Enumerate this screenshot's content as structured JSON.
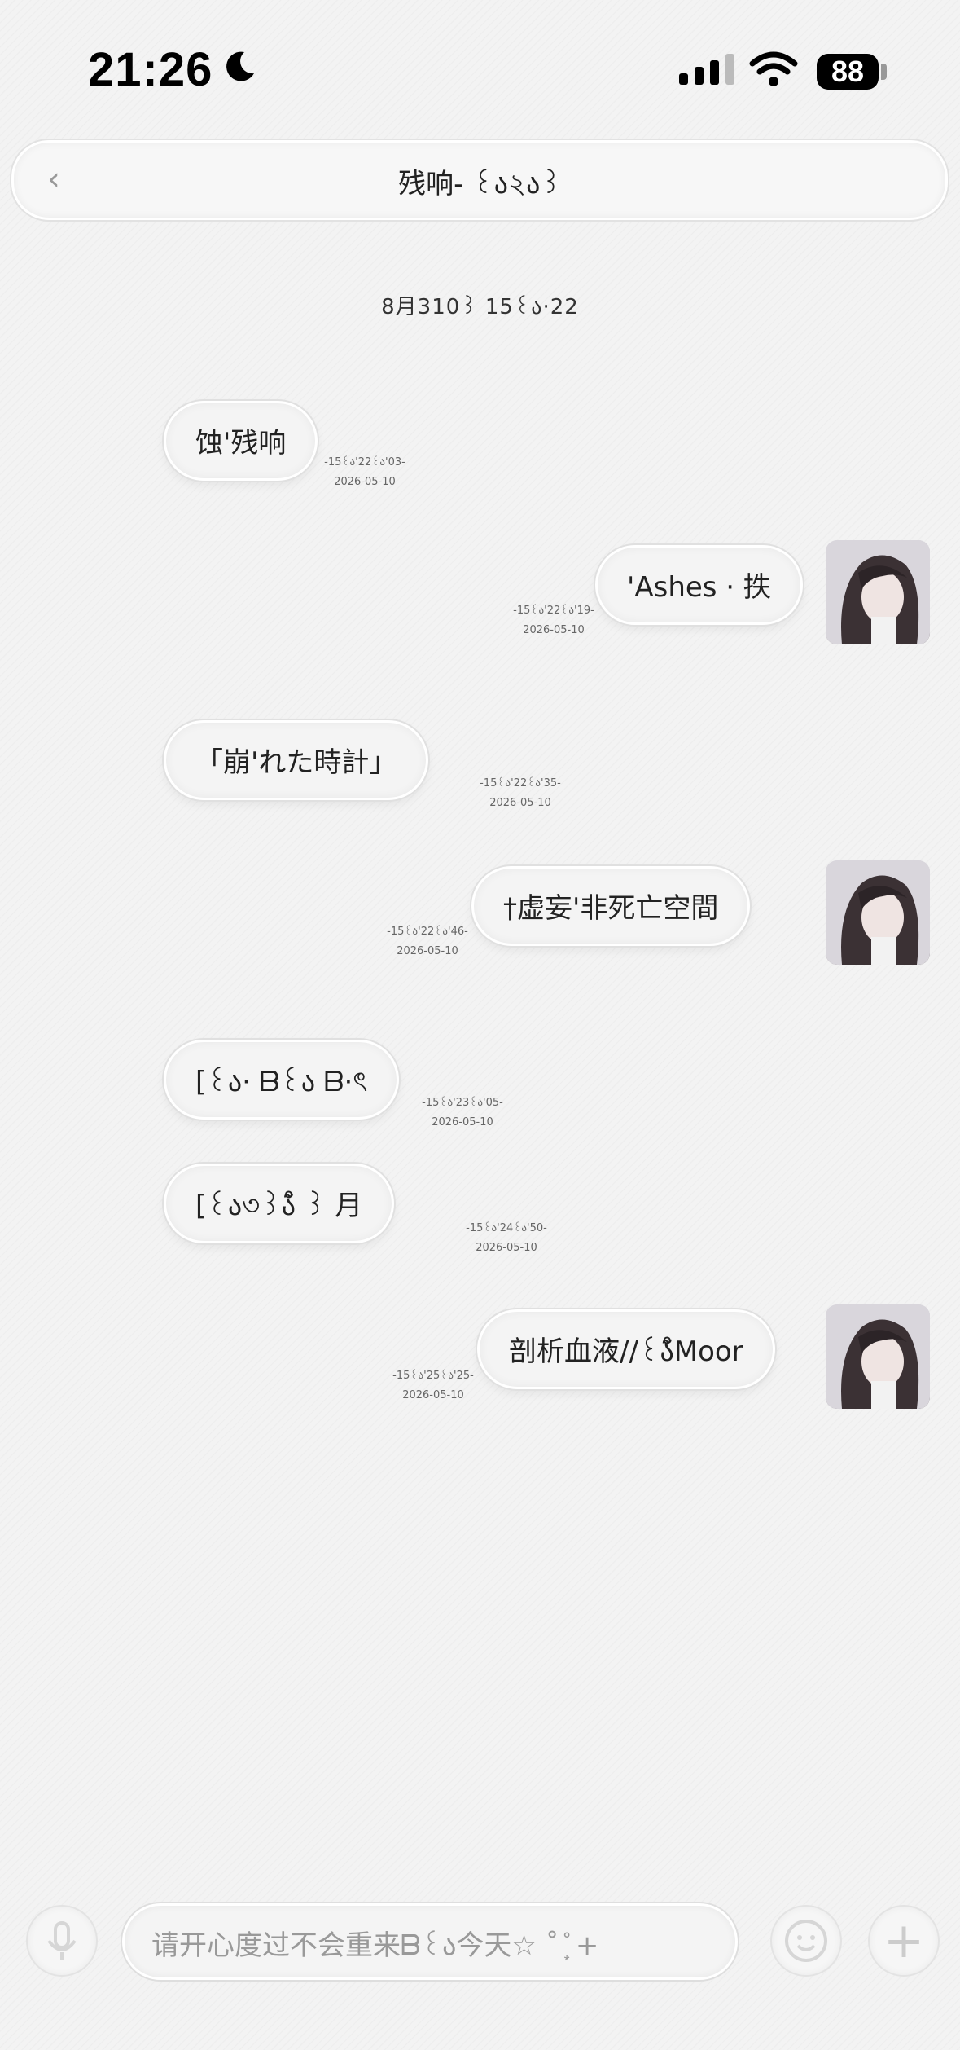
{
  "status_bar": {
    "time": "21:26",
    "battery": "88"
  },
  "header": {
    "title": "残响-  ꒰ა২ა꒱"
  },
  "date_divider": "8月310꒱ 15꒰ა·22",
  "messages": [
    {
      "side": "left",
      "text": "蚀'残响",
      "ts1": "-15꒰ა'22꒰ა'03-",
      "ts2": "2026-05-10"
    },
    {
      "side": "right",
      "text": "'Ashes · 抶",
      "ts1": "-15꒰ა'22꒰ა'19-",
      "ts2": "2026-05-10"
    },
    {
      "side": "left",
      "text": "「崩'れた時計」",
      "ts1": "-15꒰ა'22꒰ა'35-",
      "ts2": "2026-05-10"
    },
    {
      "side": "right",
      "text": "†虚妄'非死亡空間",
      "ts1": "-15꒰ა'22꒰ა'46-",
      "ts2": "2026-05-10"
    },
    {
      "side": "left",
      "text": "[꒰ა·  ᗷ꒰ა  ᗷ·ৎ",
      "ts1": "-15꒰ა'23꒰ა'05-",
      "ts2": "2026-05-10"
    },
    {
      "side": "left",
      "text": "[꒰ა৩꒱ა̊̃ ꒱ 月",
      "ts1": "-15꒰ა'24꒰ა'50-",
      "ts2": "2026-05-10"
    },
    {
      "side": "right",
      "text": "剖析血液//꒰ა̊̃Moor",
      "ts1": "-15꒰ა'25꒰ა'25-",
      "ts2": "2026-05-10"
    }
  ],
  "composer": {
    "text": "请开心度过不会重来ᗷ꒰ა今天☆  ˚ ͙̊ +"
  },
  "colors": {
    "bubble": "#f4f4f4",
    "background": "#f1f1f1"
  }
}
